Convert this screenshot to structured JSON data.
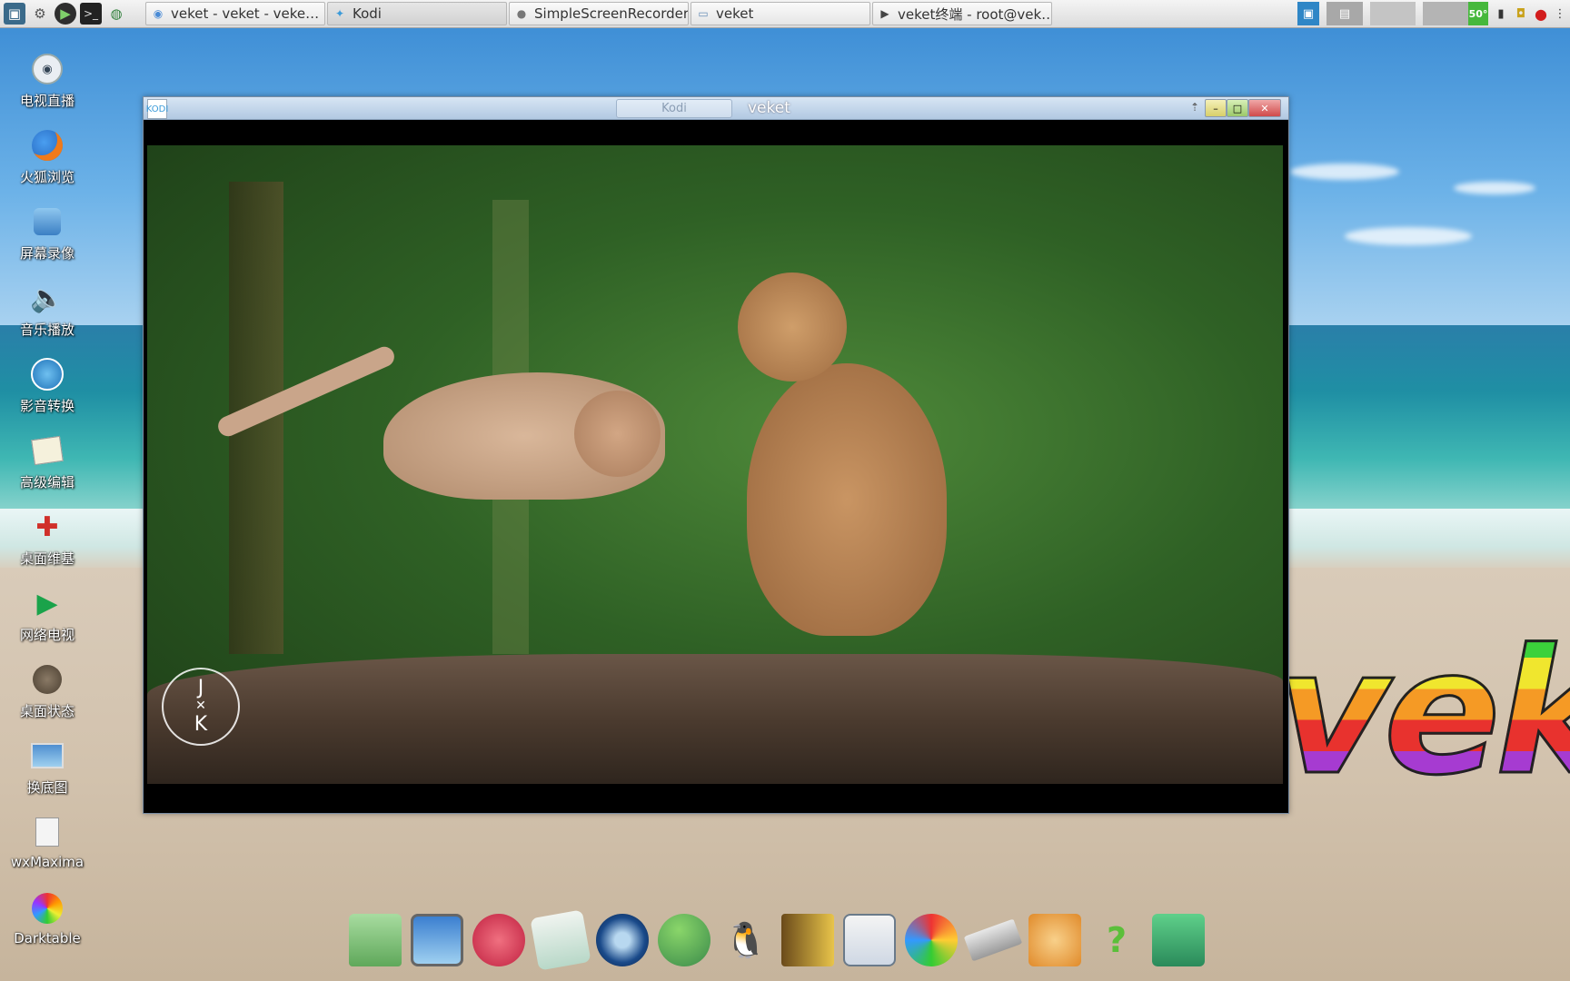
{
  "taskbar": {
    "launchers": [
      {
        "icon": "system-monitor-icon"
      },
      {
        "icon": "settings-gear-icon"
      },
      {
        "icon": "play-icon"
      },
      {
        "icon": "terminal-icon"
      },
      {
        "icon": "globe-icon"
      }
    ],
    "tasks": [
      {
        "label": "veket - veket - veke…",
        "icon": "browser-icon",
        "active": false
      },
      {
        "label": "Kodi",
        "icon": "kodi-icon",
        "active": true
      },
      {
        "label": "SimpleScreenRecorder",
        "icon": "recorder-icon",
        "active": false
      },
      {
        "label": "veket",
        "icon": "folder-icon",
        "active": false
      },
      {
        "label": "veket终端 - root@vek…",
        "icon": "terminal-icon",
        "active": false
      }
    ],
    "tray": {
      "temperature": "50°"
    }
  },
  "desktop_icons": [
    {
      "label": "电视直播",
      "icon": "tv-icon"
    },
    {
      "label": "火狐浏览",
      "icon": "firefox-icon"
    },
    {
      "label": "屏幕录像",
      "icon": "screen-record-icon"
    },
    {
      "label": "音乐播放",
      "icon": "speaker-icon"
    },
    {
      "label": "影音转换",
      "icon": "media-convert-icon"
    },
    {
      "label": "高级编辑",
      "icon": "text-editor-icon"
    },
    {
      "label": "桌面维基",
      "icon": "wiki-icon"
    },
    {
      "label": "网络电视",
      "icon": "play-triangle-icon"
    },
    {
      "label": "桌面状态",
      "icon": "status-icon"
    },
    {
      "label": "换底图",
      "icon": "wallpaper-icon"
    },
    {
      "label": "wxMaxima",
      "icon": "maxima-icon"
    },
    {
      "label": "Darktable",
      "icon": "darktable-icon"
    }
  ],
  "window": {
    "title": "veket",
    "tab_label": "Kodi",
    "app_icon_text": "KODI",
    "watermark_letters": [
      "J",
      "K"
    ]
  },
  "wallpaper": {
    "logo_text": "veket"
  },
  "dock": [
    {
      "icon": "folder-icon"
    },
    {
      "icon": "monitor-icon"
    },
    {
      "icon": "hedgehog-icon"
    },
    {
      "icon": "notepad-icon"
    },
    {
      "icon": "media-player-icon"
    },
    {
      "icon": "users-icon"
    },
    {
      "icon": "penguin-icon"
    },
    {
      "icon": "address-book-icon"
    },
    {
      "icon": "chart-icon"
    },
    {
      "icon": "paint-palette-icon"
    },
    {
      "icon": "usb-drive-icon"
    },
    {
      "icon": "mascot-icon"
    },
    {
      "icon": "help-icon"
    },
    {
      "icon": "camera-icon"
    }
  ]
}
